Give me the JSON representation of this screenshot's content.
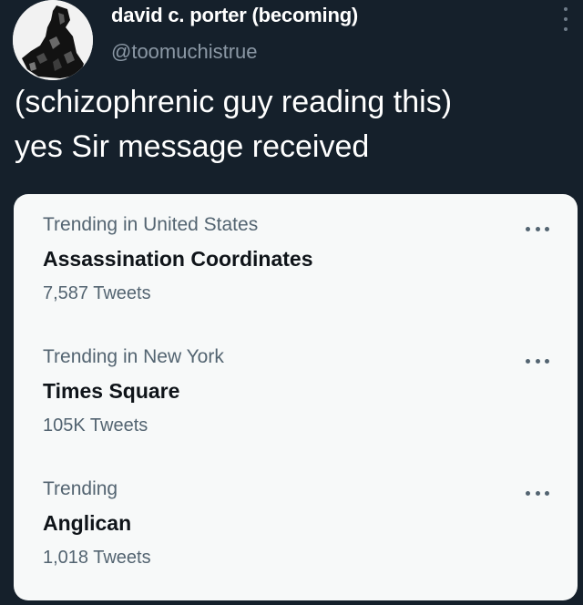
{
  "author": {
    "name": "david c. porter (becoming)",
    "handle": "@toomuchistrue"
  },
  "tweet": {
    "lines": [
      "(schizophrenic guy reading this)",
      "yes Sir message received"
    ]
  },
  "trends": [
    {
      "context": "Trending in United States",
      "name": "Assassination Coordinates",
      "count": "7,587 Tweets"
    },
    {
      "context": "Trending in New York",
      "name": "Times Square",
      "count": "105K Tweets"
    },
    {
      "context": "Trending",
      "name": "Anglican",
      "count": "1,018 Tweets"
    }
  ],
  "icons": {
    "tweet_menu": "vertical-dots-icon",
    "trend_menu": "horizontal-dots-icon"
  },
  "colors": {
    "background": "#15202b",
    "card": "#f7f9f9",
    "secondary_text_dark": "#8b98a5",
    "secondary_text_light": "#536471"
  }
}
